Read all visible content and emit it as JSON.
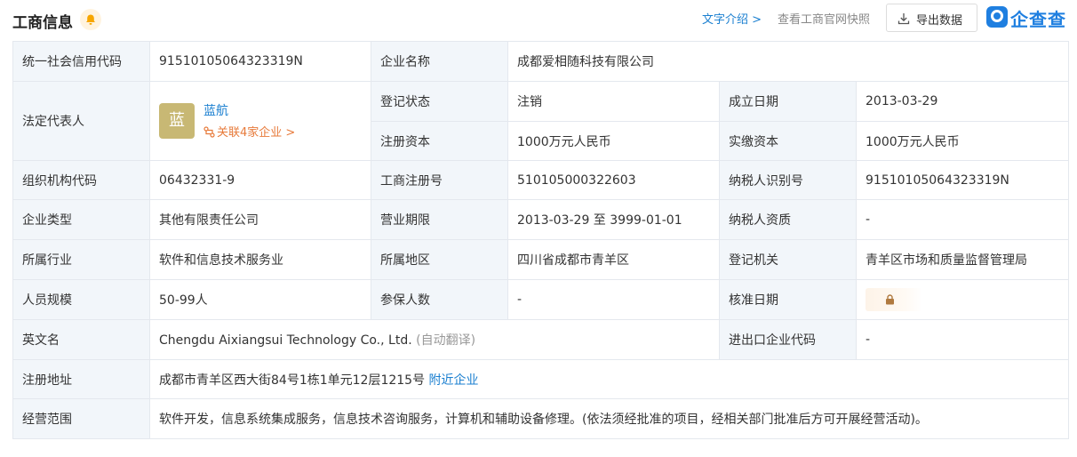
{
  "header": {
    "title": "工商信息",
    "intro_link": "文字介绍 >",
    "snapshot_link": "查看工商官网快照",
    "export_label": "导出数据",
    "logo_text": "企查查",
    "colors": {
      "accent": "#1a7fd0",
      "logo": "#1f7fe0",
      "bell": "#f7a600",
      "key_bg": "#f2f6fa",
      "related": "#e77a3a"
    }
  },
  "fields": {
    "credit_code": {
      "label": "统一社会信用代码",
      "value": "91510105064323319N"
    },
    "company_name": {
      "label": "企业名称",
      "value": "成都爱相随科技有限公司"
    },
    "legal_rep": {
      "label": "法定代表人",
      "avatar_char": "蓝",
      "name": "蓝航",
      "related": "关联4家企业 >"
    },
    "reg_status": {
      "label": "登记状态",
      "value": "注销"
    },
    "founded": {
      "label": "成立日期",
      "value": "2013-03-29"
    },
    "reg_capital": {
      "label": "注册资本",
      "value": "1000万元人民币"
    },
    "paid_capital": {
      "label": "实缴资本",
      "value": "1000万元人民币"
    },
    "org_code": {
      "label": "组织机构代码",
      "value": "06432331-9"
    },
    "biz_reg_no": {
      "label": "工商注册号",
      "value": "510105000322603"
    },
    "taxpayer_id": {
      "label": "纳税人识别号",
      "value": "91510105064323319N"
    },
    "company_type": {
      "label": "企业类型",
      "value": "其他有限责任公司"
    },
    "biz_term": {
      "label": "营业期限",
      "value": "2013-03-29 至 3999-01-01"
    },
    "taxpayer_quali": {
      "label": "纳税人资质",
      "value": "-"
    },
    "industry": {
      "label": "所属行业",
      "value": "软件和信息技术服务业"
    },
    "region": {
      "label": "所属地区",
      "value": "四川省成都市青羊区"
    },
    "reg_authority": {
      "label": "登记机关",
      "value": "青羊区市场和质量监督管理局"
    },
    "staff_size": {
      "label": "人员规模",
      "value": "50-99人"
    },
    "insured": {
      "label": "参保人数",
      "value": "-"
    },
    "approval_date": {
      "label": "核准日期",
      "icon": "lock-icon"
    },
    "english_name": {
      "label": "英文名",
      "value": "Chengdu Aixiangsui Technology Co., Ltd.",
      "note": "(自动翻译)"
    },
    "import_export": {
      "label": "进出口企业代码",
      "value": "-"
    },
    "reg_address": {
      "label": "注册地址",
      "value": "成都市青羊区西大街84号1栋1单元12层1215号",
      "nearby": "附近企业"
    },
    "biz_scope": {
      "label": "经营范围",
      "value": "软件开发，信息系统集成服务，信息技术咨询服务，计算机和辅助设备修理。(依法须经批准的项目，经相关部门批准后方可开展经营活动)。"
    }
  }
}
